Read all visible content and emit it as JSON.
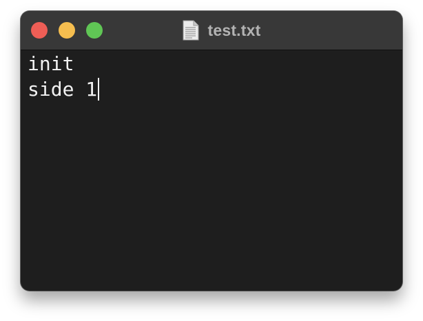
{
  "window": {
    "title": "test.txt",
    "controls": {
      "close": {
        "label": "Close",
        "color": "#ee5e56"
      },
      "minimize": {
        "label": "Minimize",
        "color": "#f6be4f"
      },
      "zoom": {
        "label": "Zoom",
        "color": "#60c655"
      }
    },
    "title_icon": "text-document-icon"
  },
  "editor": {
    "lines": [
      "init",
      "side 1"
    ],
    "cursor_line": 2
  },
  "colors": {
    "editor_background": "#1e1e1e",
    "titlebar_background": "#383838",
    "text": "#f2f2f2",
    "title_text": "#b3b3b3"
  }
}
